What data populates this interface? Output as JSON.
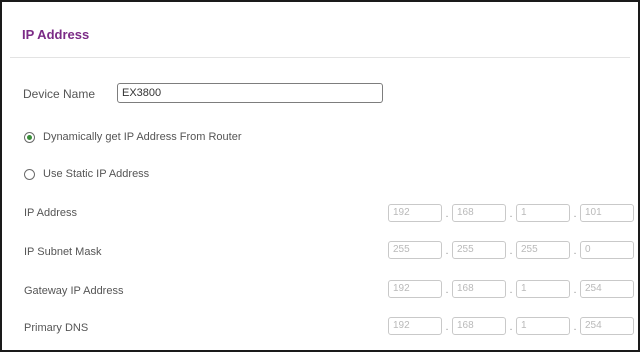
{
  "section": {
    "title": "IP Address"
  },
  "device": {
    "label": "Device Name",
    "value": "EX3800"
  },
  "options": [
    {
      "label": "Dynamically get IP Address From Router",
      "selected": true
    },
    {
      "label": "Use Static IP Address",
      "selected": false
    }
  ],
  "fields": [
    {
      "label": "IP Address",
      "octets": [
        "192",
        "168",
        "1",
        "101"
      ]
    },
    {
      "label": "IP Subnet Mask",
      "octets": [
        "255",
        "255",
        "255",
        "0"
      ]
    },
    {
      "label": "Gateway IP Address",
      "octets": [
        "192",
        "168",
        "1",
        "254"
      ]
    },
    {
      "label": "Primary DNS",
      "octets": [
        "192",
        "168",
        "1",
        "254"
      ]
    }
  ],
  "separator": ".",
  "colors": {
    "title": "#7b2b86",
    "radio_selected": "#3a8d3a"
  }
}
